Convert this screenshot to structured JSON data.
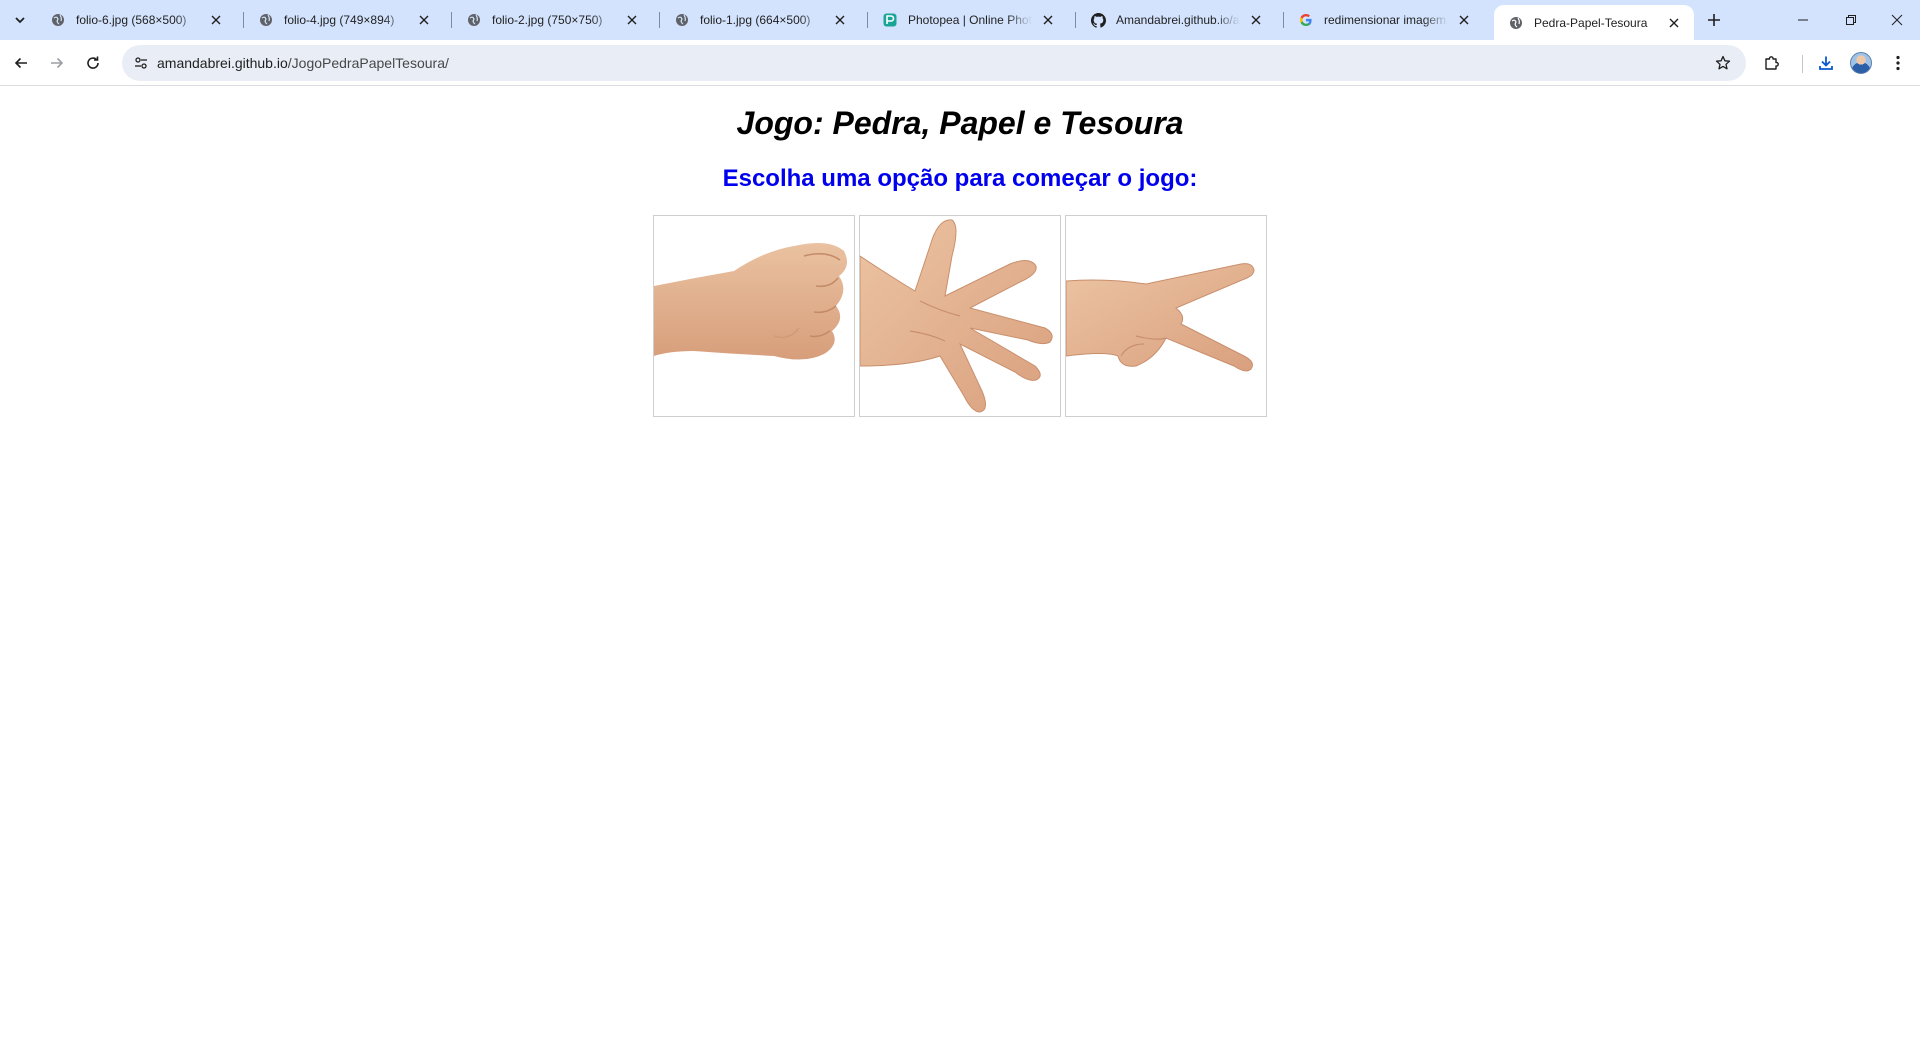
{
  "browser": {
    "tabs": [
      {
        "title": "folio-6.jpg (568×500)",
        "favicon": "globe-icon"
      },
      {
        "title": "folio-4.jpg (749×894)",
        "favicon": "globe-icon"
      },
      {
        "title": "folio-2.jpg (750×750)",
        "favicon": "globe-icon"
      },
      {
        "title": "folio-1.jpg (664×500)",
        "favicon": "globe-icon"
      },
      {
        "title": "Photopea | Online Photo Editor",
        "favicon": "photopea-icon"
      },
      {
        "title": "Amandabrei.github.io/assets",
        "favicon": "github-icon"
      },
      {
        "title": "redimensionar imagem pixels",
        "favicon": "google-icon"
      },
      {
        "title": "Pedra-Papel-Tesoura",
        "favicon": "globe-icon",
        "active": true
      }
    ],
    "url": {
      "host": "amandabrei.github.io",
      "path": "/JogoPedraPapelTesoura/"
    }
  },
  "page": {
    "title": "Jogo: Pedra, Papel e Tesoura",
    "subtitle": "Escolha uma opção para começar o jogo:",
    "choices": [
      {
        "name": "pedra",
        "icon": "fist-hand-icon"
      },
      {
        "name": "papel",
        "icon": "open-hand-icon"
      },
      {
        "name": "tesoura",
        "icon": "scissors-hand-icon"
      }
    ]
  },
  "colors": {
    "tabstrip": "#d3e3fd",
    "omnibox": "#e9eef6",
    "subtitle": "#0000ee",
    "skin": "#e8b896"
  }
}
